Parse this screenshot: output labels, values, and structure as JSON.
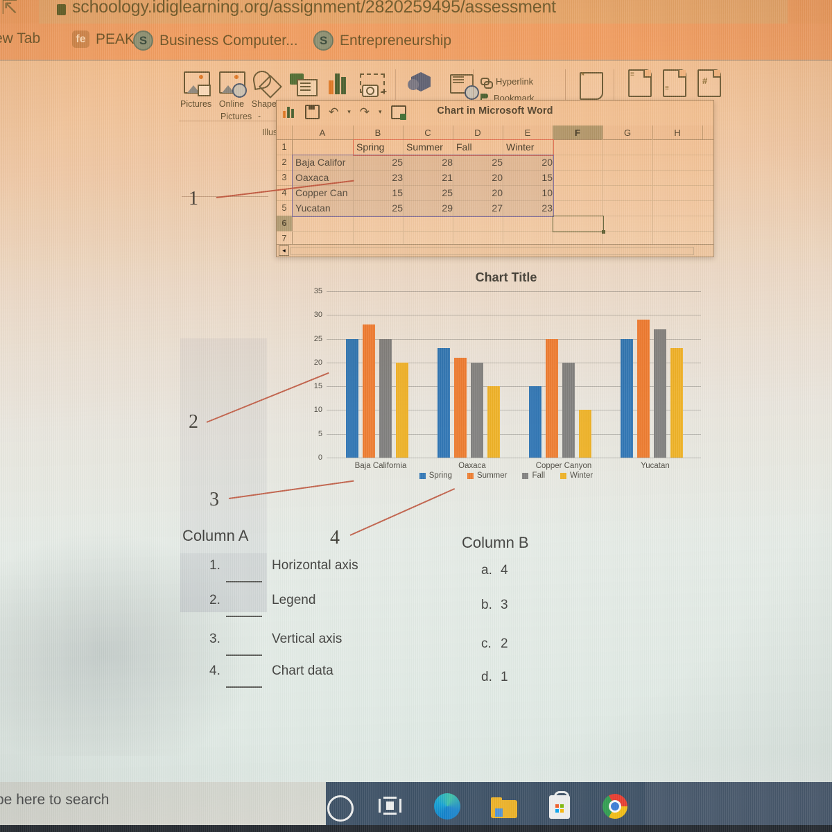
{
  "browser": {
    "url": "schoology.idiglearning.org/assignment/2820259495/assessment",
    "lock_icon": "lock-icon",
    "bookmarks": [
      {
        "label": "ew Tab",
        "icon": "none"
      },
      {
        "label": "PEAK",
        "icon": "fe"
      },
      {
        "label": "Business Computer...",
        "icon": "S"
      },
      {
        "label": "Entrepreneurship",
        "icon": "S"
      }
    ]
  },
  "word_ribbon": {
    "items": [
      {
        "label": "Pictures",
        "icon": "pictures-icon"
      },
      {
        "label": "Online",
        "label2": "Pictures",
        "icon": "online-pictures-icon"
      },
      {
        "label": "Shapes",
        "label2": "-",
        "icon": "shapes-icon"
      },
      {
        "label": "",
        "icon": "smartart-icon"
      },
      {
        "label": "",
        "icon": "chart-icon"
      },
      {
        "label": "",
        "icon": "screenshot-icon"
      },
      {
        "label": "",
        "icon": "3d-model-icon"
      },
      {
        "label": "",
        "icon": "online-video-icon"
      }
    ],
    "group_label": "Illus",
    "links": [
      {
        "label": "Hyperlink",
        "icon": "chain-icon"
      },
      {
        "label": "Bookmark",
        "icon": "flag-icon"
      }
    ]
  },
  "sheet_window": {
    "title": "Chart in Microsoft Word",
    "quick_access": [
      "chart-icon",
      "save-icon",
      "undo-icon",
      "redo-icon",
      "edit-in-excel-icon"
    ],
    "column_headers": [
      "A",
      "B",
      "C",
      "D",
      "E",
      "F",
      "G",
      "H"
    ],
    "selected_column": "F",
    "row_headers": [
      "1",
      "2",
      "3",
      "4",
      "5",
      "6",
      "7"
    ],
    "selected_row": "6",
    "rows": [
      {
        "label": "",
        "values": [
          "Spring",
          "Summer",
          "Fall",
          "Winter"
        ]
      },
      {
        "label": "Baja Califor",
        "values": [
          "25",
          "28",
          "25",
          "20"
        ]
      },
      {
        "label": "Oaxaca",
        "values": [
          "23",
          "21",
          "20",
          "15"
        ]
      },
      {
        "label": "Copper Can",
        "values": [
          "15",
          "25",
          "20",
          "10"
        ]
      },
      {
        "label": "Yucatan",
        "values": [
          "25",
          "29",
          "27",
          "23"
        ]
      }
    ]
  },
  "chart_data": {
    "type": "bar",
    "title": "Chart Title",
    "categories": [
      "Baja California",
      "Oaxaca",
      "Copper Canyon",
      "Yucatan"
    ],
    "series": [
      {
        "name": "Spring",
        "color": "#2e75b6",
        "values": [
          25,
          23,
          15,
          25
        ]
      },
      {
        "name": "Summer",
        "color": "#ed7d31",
        "values": [
          28,
          21,
          25,
          29
        ]
      },
      {
        "name": "Fall",
        "color": "#808080",
        "values": [
          25,
          20,
          20,
          27
        ]
      },
      {
        "name": "Winter",
        "color": "#f0b429",
        "values": [
          20,
          15,
          10,
          23
        ]
      }
    ],
    "yticks": [
      0,
      5,
      10,
      15,
      20,
      25,
      30,
      35
    ],
    "ylim": [
      0,
      35
    ],
    "xlabel": "",
    "ylabel": "",
    "grid": true,
    "legend_position": "bottom"
  },
  "annotations": [
    {
      "number": "1",
      "points_to": "chart-data-spreadsheet"
    },
    {
      "number": "2",
      "points_to": "vertical-axis"
    },
    {
      "number": "3",
      "points_to": "horizontal-axis"
    },
    {
      "number": "4",
      "points_to": "legend"
    }
  ],
  "matching": {
    "column_a_header": "Column A",
    "column_b_header": "Column B",
    "column_a": [
      {
        "num": "1.",
        "label": "Horizontal axis",
        "answer": ""
      },
      {
        "num": "2.",
        "label": "Legend",
        "answer": ""
      },
      {
        "num": "3.",
        "label": "Vertical axis",
        "answer": ""
      },
      {
        "num": "4.",
        "label": "Chart data",
        "answer": ""
      }
    ],
    "column_b": [
      {
        "letter": "a.",
        "value": "4"
      },
      {
        "letter": "b.",
        "value": "3"
      },
      {
        "letter": "c.",
        "value": "2"
      },
      {
        "letter": "d.",
        "value": "1"
      }
    ]
  },
  "taskbar": {
    "search_placeholder": "pe here to search",
    "icons": [
      {
        "name": "cortana-icon"
      },
      {
        "name": "task-view-icon"
      },
      {
        "name": "edge-icon"
      },
      {
        "name": "file-explorer-icon"
      },
      {
        "name": "microsoft-store-icon"
      },
      {
        "name": "chrome-icon"
      }
    ]
  }
}
